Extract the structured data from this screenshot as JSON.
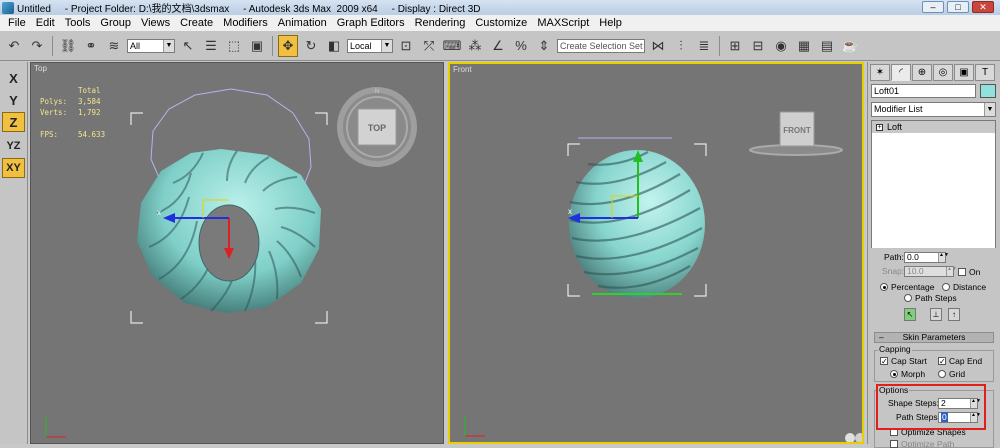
{
  "window": {
    "title": "Untitled     - Project Folder: D:\\我的文档\\3dsmax     - Autodesk 3ds Max  2009 x64     - Display : Direct 3D",
    "controls": [
      "–",
      "□",
      "✕"
    ]
  },
  "menu": [
    "File",
    "Edit",
    "Tools",
    "Group",
    "Views",
    "Create",
    "Modifiers",
    "Animation",
    "Graph Editors",
    "Rendering",
    "Customize",
    "MAXScript",
    "Help"
  ],
  "toolbar": {
    "filter_value": "All",
    "coord_value": "Local",
    "selection_set_placeholder": "Create Selection Set"
  },
  "axis_buttons": [
    "X",
    "Y",
    "Z",
    "YZ",
    "XY"
  ],
  "viewports": {
    "top": {
      "label": "Top",
      "nav_label": "TOP",
      "stats": {
        "header": "Total",
        "polys_label": "Polys:",
        "polys": "3,584",
        "verts_label": "Verts:",
        "verts": "1,792",
        "fps_label": "FPS:",
        "fps": "54.633"
      }
    },
    "front": {
      "label": "Front",
      "nav_label": "FRONT"
    }
  },
  "command_panel": {
    "object_name": "Loft01",
    "object_color": "#8fe3dc",
    "modifier_list": "Modifier List",
    "stack_item": "Loft",
    "path": {
      "path_label": "Path:",
      "path_value": "0.0",
      "snap_label": "Snap:",
      "snap_value": "10.0",
      "on_label": "On",
      "percentage_label": "Percentage",
      "distance_label": "Distance",
      "path_steps_label": "Path Steps"
    },
    "skin": {
      "title": "Skin Parameters",
      "capping_title": "Capping",
      "cap_start": "Cap Start",
      "cap_end": "Cap End",
      "morph": "Morph",
      "grid": "Grid",
      "options_title": "Options",
      "shape_steps_label": "Shape Steps:",
      "shape_steps_value": "2",
      "path_steps_label": "Path Steps:",
      "path_steps_value": "0",
      "optimize_shapes": "Optimize Shapes",
      "optimize_path": "Optimize Path"
    }
  },
  "colors": {
    "active_axis": "#f0c040",
    "viewport_bg": "#757575",
    "active_viewport_border": "#e8d000",
    "object_surface": "#8fd9d2",
    "highlight_box": "#e0201c"
  }
}
